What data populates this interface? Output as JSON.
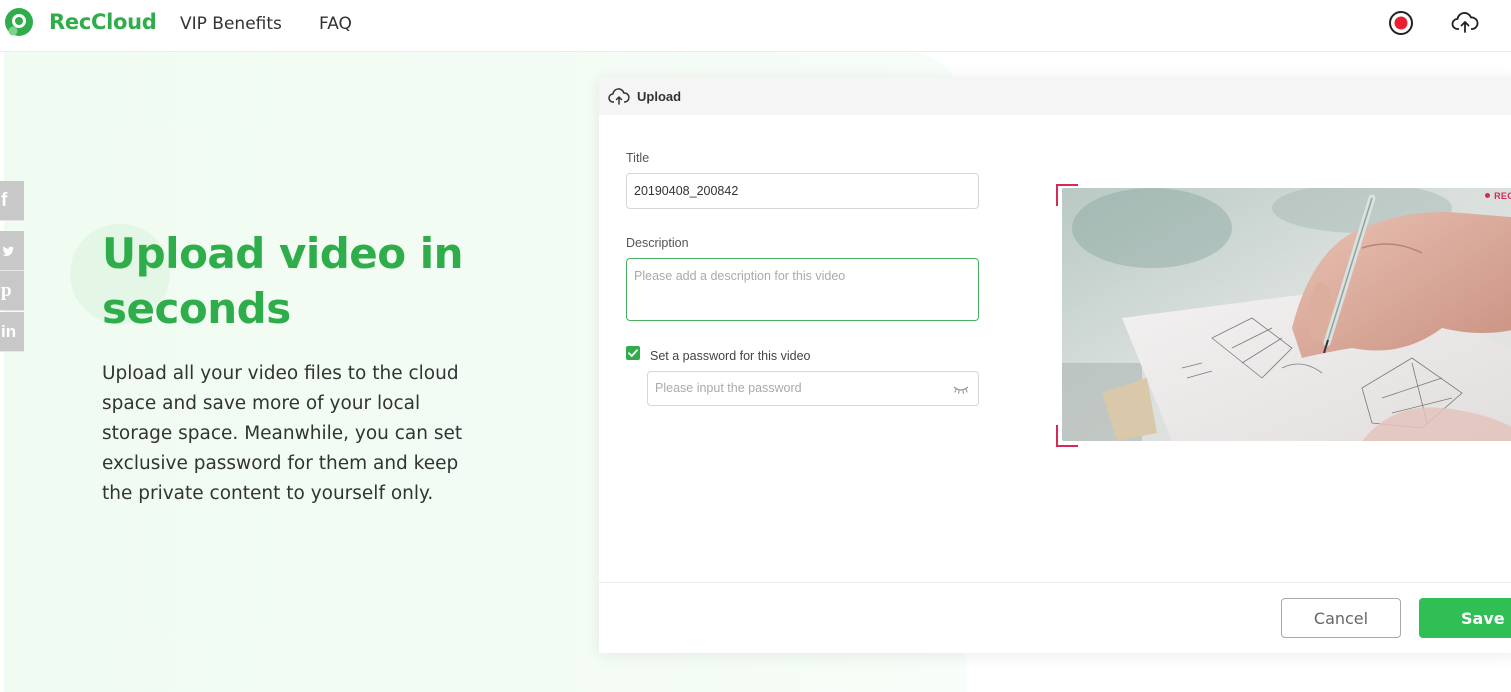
{
  "app": {
    "brand": "RecCloud",
    "brand_color": "#2fad4b",
    "accent_color": "#2fbf55",
    "record_color": "#e8202f"
  },
  "header": {
    "nav": [
      "VIP Benefits",
      "FAQ"
    ],
    "icons": [
      "record-icon",
      "cloud-upload-icon"
    ]
  },
  "social": [
    "f",
    "twitter",
    "pinterest",
    "in"
  ],
  "hero": {
    "title": "Upload video in seconds",
    "description": "Upload all your video files to the cloud space and save more of your local storage space. Meanwhile, you can set exclusive password for them and keep the private content to yourself only."
  },
  "upload": {
    "panel_title": "Upload",
    "title_label": "Title",
    "title_value": "20190408_200842",
    "description_label": "Description",
    "description_placeholder": "Please add a description for this video",
    "password_checkbox_label": "Set a password for this video",
    "password_checked": true,
    "password_placeholder": "Please input the password",
    "preview_tag": "REC",
    "cancel_label": "Cancel",
    "save_label": "Save"
  }
}
